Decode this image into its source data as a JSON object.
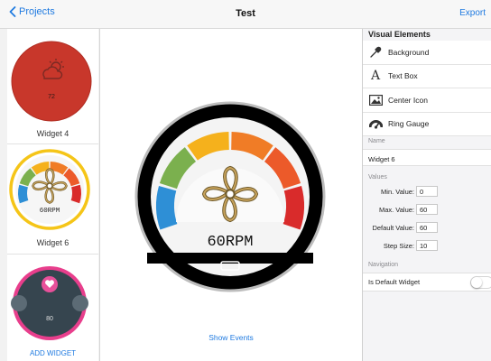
{
  "nav": {
    "back_label": "Projects",
    "title": "Test",
    "export_label": "Export"
  },
  "sidebar": {
    "widgets": [
      {
        "label": "Widget 4",
        "value_text": "72",
        "icon": "cloud-sun-icon"
      },
      {
        "label": "Widget 6",
        "value_text": "60RPM",
        "icon": "fan-icon",
        "selected": true
      },
      {
        "label": "",
        "value_text": "80",
        "icon": "heart-icon"
      }
    ],
    "add_widget_label": "ADD WIDGET"
  },
  "preview": {
    "value_text": "60RPM",
    "icon": "fan-icon",
    "show_events_label": "Show Events",
    "gauge_colors": [
      "#2e8fd6",
      "#7bb04e",
      "#f5b11c",
      "#f07c26",
      "#ec5a2a",
      "#d92b2b"
    ]
  },
  "panel": {
    "header": "Visual Elements",
    "elements": [
      {
        "label": "Background",
        "icon": "eyedropper-icon"
      },
      {
        "label": "Text Box",
        "icon": "text-icon"
      },
      {
        "label": "Center Icon",
        "icon": "image-icon"
      },
      {
        "label": "Ring Gauge",
        "icon": "gauge-icon"
      }
    ],
    "name_section": "Name",
    "name_value": "Widget 6",
    "values_section": "Values",
    "values": [
      {
        "label": "Min. Value:",
        "value": "0"
      },
      {
        "label": "Max. Value:",
        "value": "60"
      },
      {
        "label": "Default Value:",
        "value": "60"
      },
      {
        "label": "Step Size:",
        "value": "10"
      }
    ],
    "navigation_section": "Navigation",
    "default_widget_label": "Is Default Widget",
    "default_widget_on": false
  },
  "colors": {
    "accent": "#1f7ae0",
    "selected_ring": "#f5c518",
    "widget4_bg": "#c8372b",
    "widget_pink_ring": "#e83e8c"
  }
}
